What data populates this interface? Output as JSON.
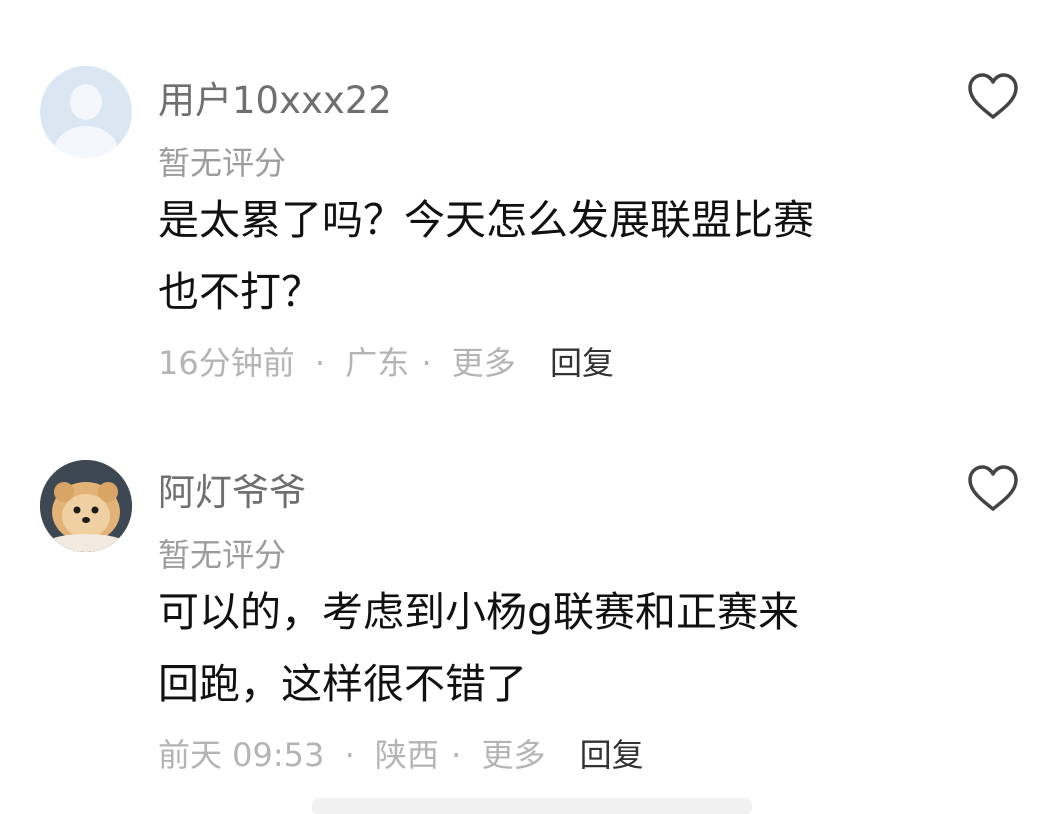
{
  "comments": [
    {
      "username": "用户10xxx22",
      "avatar": "default-avatar",
      "rating": "暂无评分",
      "content_lines": [
        "是太累了吗？今天怎么发展联盟比赛",
        "也不打？"
      ],
      "time": "16分钟前",
      "sep1": "·",
      "location": "广东",
      "sep2": "·",
      "more": "更多",
      "reply": "回复",
      "like_icon": "heart-outline-icon"
    },
    {
      "username": "阿灯爷爷",
      "avatar": "pomeranian-dog-photo",
      "rating": "暂无评分",
      "content_lines": [
        "可以的，考虑到小杨g联赛和正赛来",
        "回跑，这样很不错了"
      ],
      "time": "前天 09:53",
      "sep1": "·",
      "location": "陕西",
      "sep2": "·",
      "more": "更多",
      "reply": "回复",
      "like_icon": "heart-outline-icon"
    }
  ],
  "colors": {
    "username": "#6f6f6f",
    "rating": "#9c9c9c",
    "content": "#111111",
    "meta": "#b4b4b4",
    "reply": "#333333",
    "heart_stroke": "#444444"
  }
}
